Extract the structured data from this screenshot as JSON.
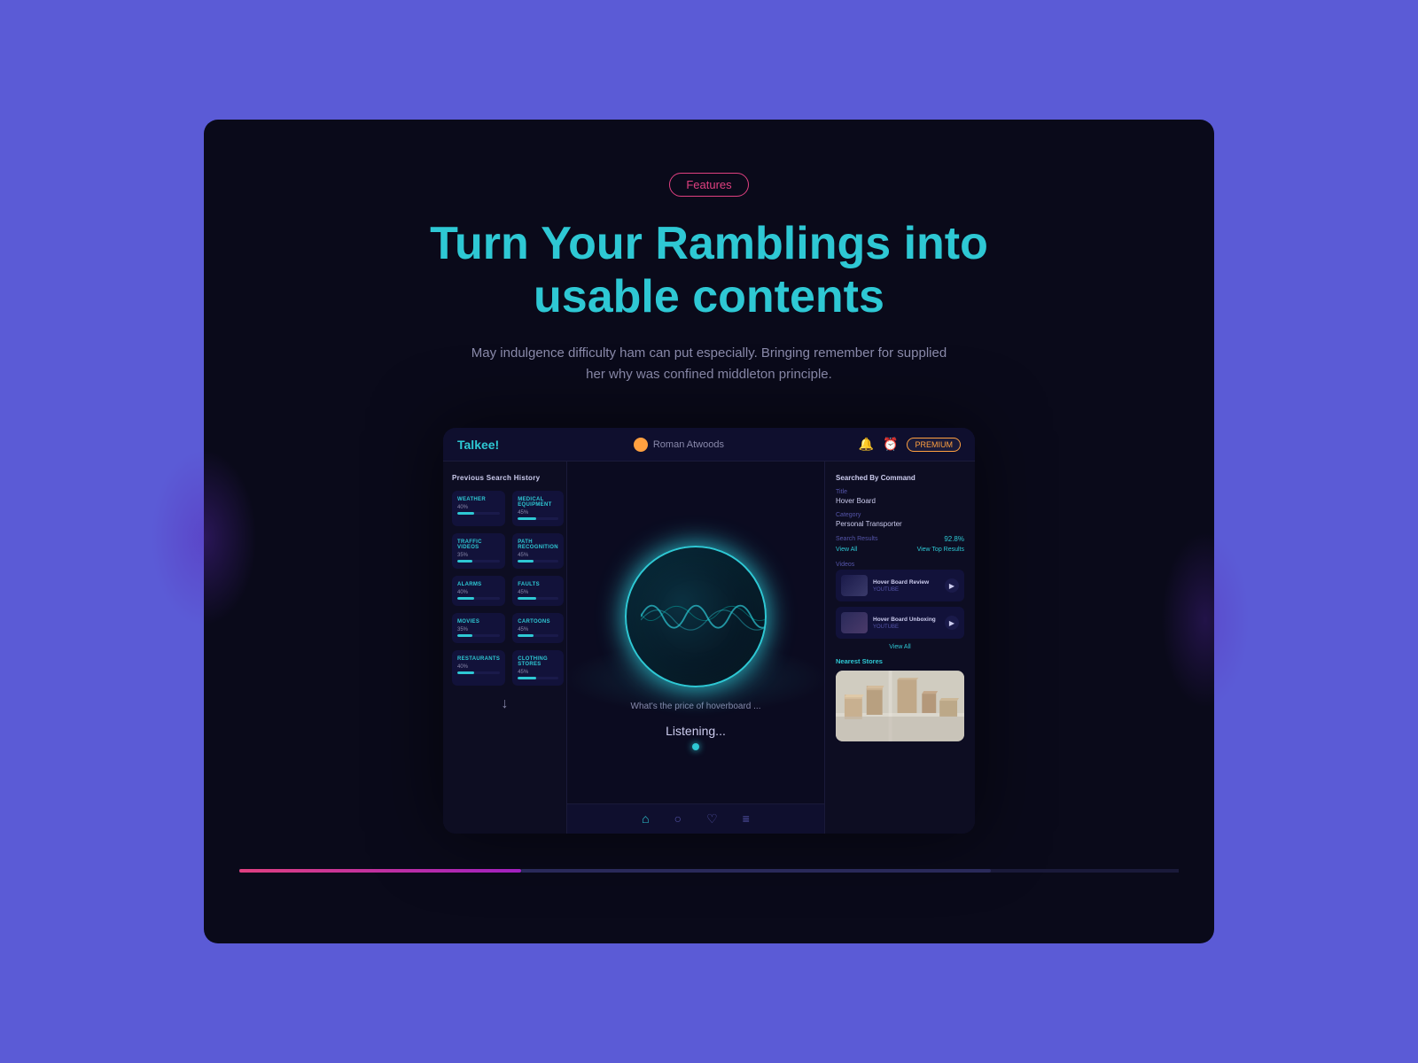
{
  "badge": {
    "label": "Features"
  },
  "headline": {
    "line1": "Turn Your Ramblings into",
    "line2": "usable contents"
  },
  "subtitle": "May indulgence difficulty ham can put especially. Bringing remember for supplied her why was confined middleton principle.",
  "app": {
    "logo": "Talkee!",
    "user": {
      "name": "Roman Atwoods"
    },
    "premium_badge": "PREMIUM",
    "left_panel": {
      "title": "Previous Search History",
      "items": [
        {
          "title": "WEATHER",
          "pct": "40%",
          "fill": 40
        },
        {
          "title": "MEDICAL EQUIPMENT",
          "pct": "45%",
          "fill": 45
        },
        {
          "title": "TRAFFIC VIDEOS",
          "pct": "35%",
          "fill": 35
        },
        {
          "title": "PATH RECOGNITION",
          "pct": "45%",
          "fill": 40
        },
        {
          "title": "ALARMS",
          "pct": "40%",
          "fill": 40
        },
        {
          "title": "FAULTS",
          "pct": "45%",
          "fill": 45
        },
        {
          "title": "MOVIES",
          "pct": "35%",
          "fill": 35
        },
        {
          "title": "CARTOONS",
          "pct": "45%",
          "fill": 40
        },
        {
          "title": "RESTAURANTS",
          "pct": "40%",
          "fill": 40
        },
        {
          "title": "CLOTHING STORES",
          "pct": "45%",
          "fill": 45
        }
      ]
    },
    "center": {
      "voice_prompt": "What's the price of hoverboard ...",
      "listening_text": "Listening...",
      "nav": [
        "🏠",
        "🔍",
        "♡",
        "≡"
      ]
    },
    "right_panel": {
      "section_title": "Searched By Command",
      "title_label": "Title",
      "title_value": "Hover Board",
      "category_label": "Category",
      "category_value": "Personal Transporter",
      "search_results_label": "Search Results",
      "search_results_pct": "92.8%",
      "view_all": "View All",
      "view_top": "View Top Results",
      "videos_label": "Videos",
      "videos": [
        {
          "title": "Hover Board Review",
          "source": "YOUTUBE"
        },
        {
          "title": "Hover Board Unboxing",
          "source": "YOUTUBE"
        }
      ],
      "view_all_link": "View All",
      "nearest_label": "Nearest Stores"
    }
  }
}
